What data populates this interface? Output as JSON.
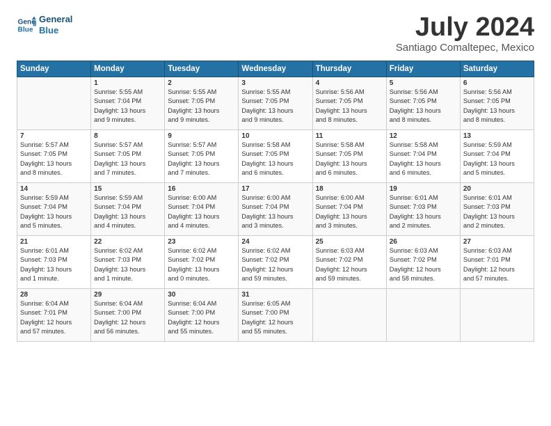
{
  "logo": {
    "line1": "General",
    "line2": "Blue"
  },
  "title": "July 2024",
  "location": "Santiago Comaltepec, Mexico",
  "days_of_week": [
    "Sunday",
    "Monday",
    "Tuesday",
    "Wednesday",
    "Thursday",
    "Friday",
    "Saturday"
  ],
  "weeks": [
    [
      {
        "day": "",
        "sunrise": "",
        "sunset": "",
        "daylight": ""
      },
      {
        "day": "1",
        "sunrise": "Sunrise: 5:55 AM",
        "sunset": "Sunset: 7:04 PM",
        "daylight": "Daylight: 13 hours and 9 minutes."
      },
      {
        "day": "2",
        "sunrise": "Sunrise: 5:55 AM",
        "sunset": "Sunset: 7:05 PM",
        "daylight": "Daylight: 13 hours and 9 minutes."
      },
      {
        "day": "3",
        "sunrise": "Sunrise: 5:55 AM",
        "sunset": "Sunset: 7:05 PM",
        "daylight": "Daylight: 13 hours and 9 minutes."
      },
      {
        "day": "4",
        "sunrise": "Sunrise: 5:56 AM",
        "sunset": "Sunset: 7:05 PM",
        "daylight": "Daylight: 13 hours and 8 minutes."
      },
      {
        "day": "5",
        "sunrise": "Sunrise: 5:56 AM",
        "sunset": "Sunset: 7:05 PM",
        "daylight": "Daylight: 13 hours and 8 minutes."
      },
      {
        "day": "6",
        "sunrise": "Sunrise: 5:56 AM",
        "sunset": "Sunset: 7:05 PM",
        "daylight": "Daylight: 13 hours and 8 minutes."
      }
    ],
    [
      {
        "day": "7",
        "sunrise": "Sunrise: 5:57 AM",
        "sunset": "Sunset: 7:05 PM",
        "daylight": "Daylight: 13 hours and 8 minutes."
      },
      {
        "day": "8",
        "sunrise": "Sunrise: 5:57 AM",
        "sunset": "Sunset: 7:05 PM",
        "daylight": "Daylight: 13 hours and 7 minutes."
      },
      {
        "day": "9",
        "sunrise": "Sunrise: 5:57 AM",
        "sunset": "Sunset: 7:05 PM",
        "daylight": "Daylight: 13 hours and 7 minutes."
      },
      {
        "day": "10",
        "sunrise": "Sunrise: 5:58 AM",
        "sunset": "Sunset: 7:05 PM",
        "daylight": "Daylight: 13 hours and 6 minutes."
      },
      {
        "day": "11",
        "sunrise": "Sunrise: 5:58 AM",
        "sunset": "Sunset: 7:05 PM",
        "daylight": "Daylight: 13 hours and 6 minutes."
      },
      {
        "day": "12",
        "sunrise": "Sunrise: 5:58 AM",
        "sunset": "Sunset: 7:04 PM",
        "daylight": "Daylight: 13 hours and 6 minutes."
      },
      {
        "day": "13",
        "sunrise": "Sunrise: 5:59 AM",
        "sunset": "Sunset: 7:04 PM",
        "daylight": "Daylight: 13 hours and 5 minutes."
      }
    ],
    [
      {
        "day": "14",
        "sunrise": "Sunrise: 5:59 AM",
        "sunset": "Sunset: 7:04 PM",
        "daylight": "Daylight: 13 hours and 5 minutes."
      },
      {
        "day": "15",
        "sunrise": "Sunrise: 5:59 AM",
        "sunset": "Sunset: 7:04 PM",
        "daylight": "Daylight: 13 hours and 4 minutes."
      },
      {
        "day": "16",
        "sunrise": "Sunrise: 6:00 AM",
        "sunset": "Sunset: 7:04 PM",
        "daylight": "Daylight: 13 hours and 4 minutes."
      },
      {
        "day": "17",
        "sunrise": "Sunrise: 6:00 AM",
        "sunset": "Sunset: 7:04 PM",
        "daylight": "Daylight: 13 hours and 3 minutes."
      },
      {
        "day": "18",
        "sunrise": "Sunrise: 6:00 AM",
        "sunset": "Sunset: 7:04 PM",
        "daylight": "Daylight: 13 hours and 3 minutes."
      },
      {
        "day": "19",
        "sunrise": "Sunrise: 6:01 AM",
        "sunset": "Sunset: 7:03 PM",
        "daylight": "Daylight: 13 hours and 2 minutes."
      },
      {
        "day": "20",
        "sunrise": "Sunrise: 6:01 AM",
        "sunset": "Sunset: 7:03 PM",
        "daylight": "Daylight: 13 hours and 2 minutes."
      }
    ],
    [
      {
        "day": "21",
        "sunrise": "Sunrise: 6:01 AM",
        "sunset": "Sunset: 7:03 PM",
        "daylight": "Daylight: 13 hours and 1 minute."
      },
      {
        "day": "22",
        "sunrise": "Sunrise: 6:02 AM",
        "sunset": "Sunset: 7:03 PM",
        "daylight": "Daylight: 13 hours and 1 minute."
      },
      {
        "day": "23",
        "sunrise": "Sunrise: 6:02 AM",
        "sunset": "Sunset: 7:02 PM",
        "daylight": "Daylight: 13 hours and 0 minutes."
      },
      {
        "day": "24",
        "sunrise": "Sunrise: 6:02 AM",
        "sunset": "Sunset: 7:02 PM",
        "daylight": "Daylight: 12 hours and 59 minutes."
      },
      {
        "day": "25",
        "sunrise": "Sunrise: 6:03 AM",
        "sunset": "Sunset: 7:02 PM",
        "daylight": "Daylight: 12 hours and 59 minutes."
      },
      {
        "day": "26",
        "sunrise": "Sunrise: 6:03 AM",
        "sunset": "Sunset: 7:02 PM",
        "daylight": "Daylight: 12 hours and 58 minutes."
      },
      {
        "day": "27",
        "sunrise": "Sunrise: 6:03 AM",
        "sunset": "Sunset: 7:01 PM",
        "daylight": "Daylight: 12 hours and 57 minutes."
      }
    ],
    [
      {
        "day": "28",
        "sunrise": "Sunrise: 6:04 AM",
        "sunset": "Sunset: 7:01 PM",
        "daylight": "Daylight: 12 hours and 57 minutes."
      },
      {
        "day": "29",
        "sunrise": "Sunrise: 6:04 AM",
        "sunset": "Sunset: 7:00 PM",
        "daylight": "Daylight: 12 hours and 56 minutes."
      },
      {
        "day": "30",
        "sunrise": "Sunrise: 6:04 AM",
        "sunset": "Sunset: 7:00 PM",
        "daylight": "Daylight: 12 hours and 55 minutes."
      },
      {
        "day": "31",
        "sunrise": "Sunrise: 6:05 AM",
        "sunset": "Sunset: 7:00 PM",
        "daylight": "Daylight: 12 hours and 55 minutes."
      },
      {
        "day": "",
        "sunrise": "",
        "sunset": "",
        "daylight": ""
      },
      {
        "day": "",
        "sunrise": "",
        "sunset": "",
        "daylight": ""
      },
      {
        "day": "",
        "sunrise": "",
        "sunset": "",
        "daylight": ""
      }
    ]
  ]
}
